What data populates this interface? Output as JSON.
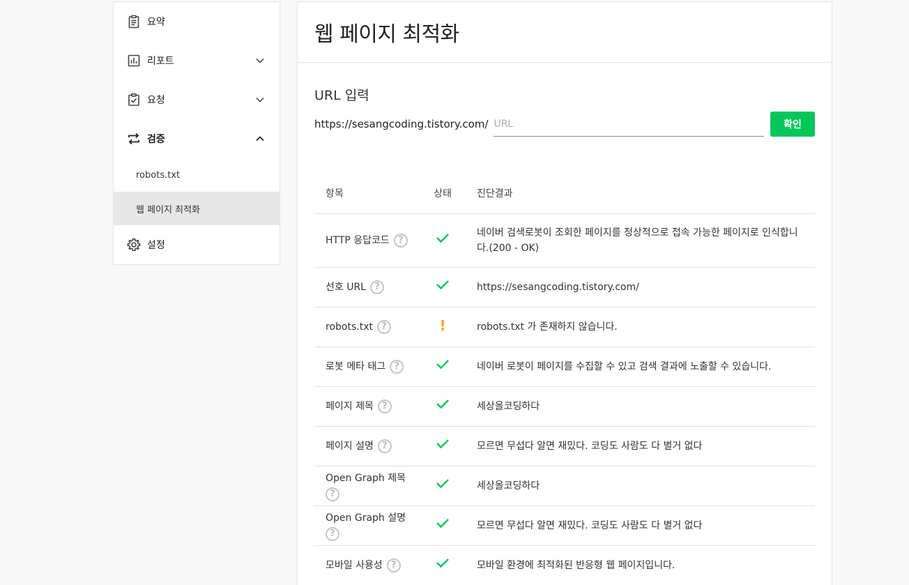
{
  "sidebar": {
    "items": [
      {
        "label": "요약",
        "icon": "clipboard-icon",
        "expandable": false
      },
      {
        "label": "리포트",
        "icon": "bar-chart-icon",
        "expandable": true,
        "expanded": false
      },
      {
        "label": "요청",
        "icon": "clipboard-check-icon",
        "expandable": true,
        "expanded": false
      },
      {
        "label": "검증",
        "icon": "repeat-icon",
        "expandable": true,
        "expanded": true,
        "children": [
          {
            "label": "robots.txt",
            "active": false
          },
          {
            "label": "웹 페이지 최적화",
            "active": true
          }
        ]
      },
      {
        "label": "설정",
        "icon": "gear-icon",
        "expandable": false
      }
    ]
  },
  "main": {
    "title": "웹 페이지 최적화",
    "url_section": {
      "title": "URL 입력",
      "prefix": "https://sesangcoding.tistory.com/",
      "placeholder": "URL",
      "value": "",
      "button_label": "확인"
    },
    "table": {
      "headers": {
        "item": "항목",
        "status": "상태",
        "result": "진단결과"
      },
      "rows": [
        {
          "item": "HTTP 응답코드",
          "status": "ok",
          "result": "네이버 검색로봇이 조회한 페이지를 정상적으로 접속 가능한 페이지로 인식합니다.(200 - OK)",
          "help_wrap": false
        },
        {
          "item": "선호 URL",
          "status": "ok",
          "result": "https://sesangcoding.tistory.com/",
          "help_wrap": false
        },
        {
          "item": "robots.txt",
          "status": "warn",
          "result": "robots.txt 가 존재하지 않습니다.",
          "help_wrap": false
        },
        {
          "item": "로봇 메타 태그",
          "status": "ok",
          "result": "네이버 로봇이 페이지를 수집할 수 있고 검색 결과에 노출할 수 있습니다.",
          "help_wrap": false
        },
        {
          "item": "페이지 제목",
          "status": "ok",
          "result": "세상올코딩하다",
          "help_wrap": false
        },
        {
          "item": "페이지 설명",
          "status": "ok",
          "result": "모르면 무섭다 알면 재밌다. 코딩도 사람도 다 별거 없다",
          "help_wrap": false
        },
        {
          "item": "Open Graph 제목",
          "status": "ok",
          "result": "세상올코딩하다",
          "help_wrap": true
        },
        {
          "item": "Open Graph 설명",
          "status": "ok",
          "result": "모르면 무섭다 알면 재밌다. 코딩도 사람도 다 별거 없다",
          "help_wrap": true
        },
        {
          "item": "모바일 사용성",
          "status": "ok",
          "result": "모바일 환경에 최적화된 반응형 웹 페이지입니다.",
          "help_wrap": false
        }
      ]
    }
  },
  "colors": {
    "accent": "#03c75a",
    "ok": "#03c75a",
    "warn": "#f5a623",
    "help": "#c6c6c6"
  },
  "help_glyph": "?",
  "warn_glyph": "!"
}
